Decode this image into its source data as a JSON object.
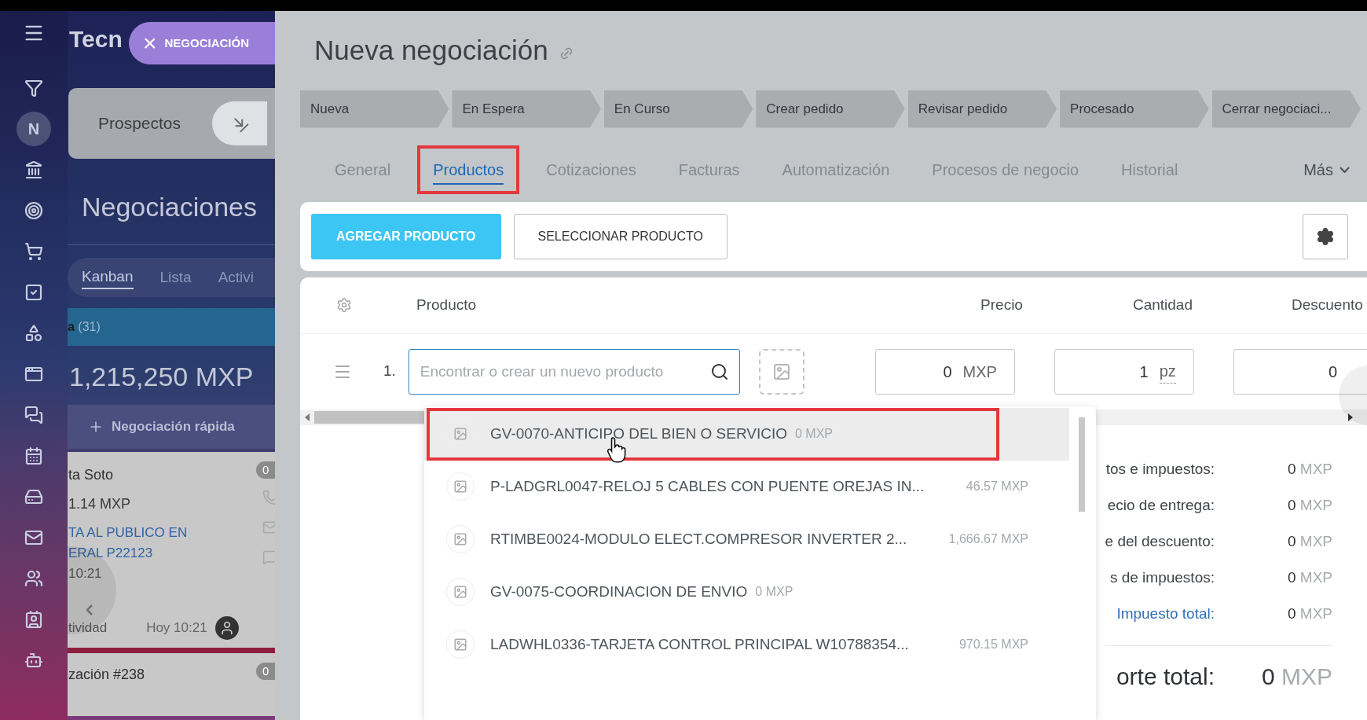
{
  "sidebar": {
    "avatar_letter": "N"
  },
  "background_page": {
    "brand": "Tecn",
    "entity_chip": {
      "close": "×",
      "label": "NEGOCIACIÓN"
    },
    "pipeline": "Prospectos",
    "title": "Negociaciones",
    "views": [
      {
        "label": "Kanban",
        "selected": true
      },
      {
        "label": "Lista",
        "selected": false
      },
      {
        "label": "Activi",
        "selected": false
      }
    ],
    "column": {
      "title": "a",
      "count": "(31)",
      "total": "1,215,250 MXP",
      "quick_add": "Negociación rápida"
    },
    "cards": [
      {
        "title": "ta Soto",
        "badge": "0",
        "amount": "1.14 MXP",
        "link_lines": [
          "TA AL PUBLICO EN",
          "ERAL P22123"
        ],
        "time": "10:21",
        "activity": "tividad",
        "date": "Hoy 10:21"
      },
      {
        "title": "zación #238",
        "badge": "0"
      }
    ]
  },
  "deal": {
    "title": "Nueva negociación",
    "stages": [
      {
        "label": "Nueva"
      },
      {
        "label": "En Espera"
      },
      {
        "label": "En Curso"
      },
      {
        "label": "Crear pedido"
      },
      {
        "label": "Revisar pedido"
      },
      {
        "label": "Procesado"
      },
      {
        "label": "Cerrar negociaci..."
      }
    ],
    "tabs": [
      {
        "label": "General",
        "selected": false,
        "highlighted": false
      },
      {
        "label": "Productos",
        "selected": true,
        "highlighted": true
      },
      {
        "label": "Cotizaciones",
        "selected": false,
        "highlighted": false
      },
      {
        "label": "Facturas",
        "selected": false,
        "highlighted": false
      },
      {
        "label": "Automatización",
        "selected": false,
        "highlighted": false
      },
      {
        "label": "Procesos de negocio",
        "selected": false,
        "highlighted": false
      },
      {
        "label": "Historial",
        "selected": false,
        "highlighted": false
      }
    ],
    "more_tab": "Más",
    "buttons": {
      "add": "AGREGAR PRODUCTO",
      "select": "SELECCIONAR PRODUCTO"
    },
    "table": {
      "columns": [
        "Producto",
        "Precio",
        "Cantidad",
        "Descuento"
      ],
      "rows": [
        {
          "number": "1.",
          "search_placeholder": "Encontrar o crear un nuevo producto",
          "price": "0",
          "currency": "MXP",
          "quantity": "1",
          "unit": "pz",
          "discount": "0"
        }
      ]
    },
    "dropdown": [
      {
        "name": "GV-0070-ANTICIPO DEL BIEN O SERVICIO",
        "price": "0 MXP",
        "hovered": true,
        "highlighted": true
      },
      {
        "name": "P-LADGRL0047-RELOJ 5 CABLES CON PUENTE OREJAS IN...",
        "price": "46.57 MXP",
        "hovered": false,
        "highlighted": false
      },
      {
        "name": "RTIMBE0024-MODULO ELECT.COMPRESOR INVERTER 2...",
        "price": "1,666.67 MXP",
        "hovered": false,
        "highlighted": false
      },
      {
        "name": "GV-0075-COORDINACION DE ENVIO",
        "price": "0 MXP",
        "hovered": false,
        "highlighted": false
      },
      {
        "name": "LADWHL0336-TARJETA CONTROL PRINCIPAL W10788354...",
        "price": "970.15 MXP",
        "hovered": false,
        "highlighted": false
      }
    ],
    "totals": [
      {
        "label": "tos e impuestos:",
        "value": "0",
        "currency": "MXP",
        "kind": "plain"
      },
      {
        "label": "ecio de entrega:",
        "value": "0",
        "currency": "MXP",
        "kind": "plain"
      },
      {
        "label": "e del descuento:",
        "value": "0",
        "currency": "MXP",
        "kind": "plain"
      },
      {
        "label": "s de impuestos:",
        "value": "0",
        "currency": "MXP",
        "kind": "plain"
      },
      {
        "label": "Impuesto total:",
        "value": "0",
        "currency": "MXP",
        "kind": "accent"
      }
    ],
    "grand_total": {
      "label": "orte total:",
      "value": "0",
      "currency": "MXP"
    }
  }
}
